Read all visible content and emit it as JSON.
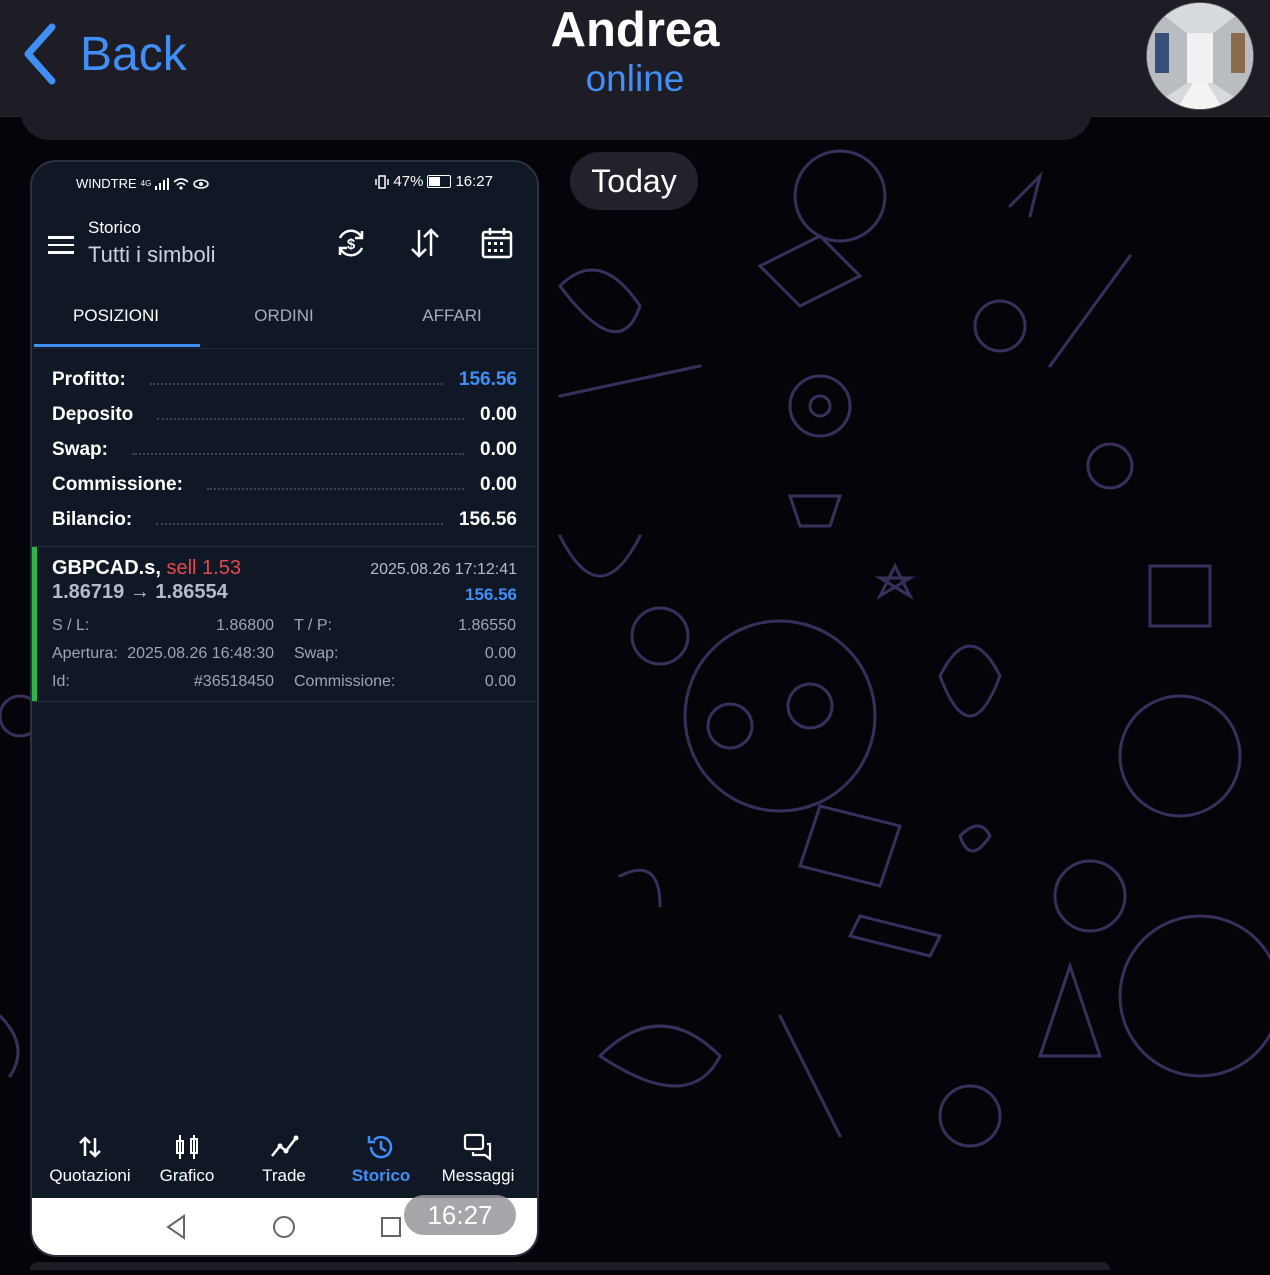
{
  "chat": {
    "back_label": "Back",
    "contact_name": "Andrea",
    "status": "online",
    "date_label": "Today",
    "message_time": "16:27"
  },
  "phone": {
    "status_bar": {
      "carrier": "WINDTRE",
      "network": "4G",
      "battery": "47%",
      "time": "16:27"
    },
    "header": {
      "title": "Storico",
      "subtitle": "Tutti i simboli"
    },
    "tabs": [
      {
        "label": "POSIZIONI",
        "active": true
      },
      {
        "label": "ORDINI",
        "active": false
      },
      {
        "label": "AFFARI",
        "active": false
      }
    ],
    "summary": [
      {
        "label": "Profitto:",
        "value": "156.56",
        "highlight": true
      },
      {
        "label": "Deposito",
        "value": "0.00",
        "highlight": false
      },
      {
        "label": "Swap:",
        "value": "0.00",
        "highlight": false
      },
      {
        "label": "Commissione:",
        "value": "0.00",
        "highlight": false
      },
      {
        "label": "Bilancio:",
        "value": "156.56",
        "highlight": false
      }
    ],
    "position": {
      "symbol": "GBPCAD.s,",
      "side": "sell 1.53",
      "datetime": "2025.08.26 17:12:41",
      "prices": "1.86719 → 1.86554",
      "profit": "156.56",
      "sl_label": "S / L:",
      "sl_value": "1.86800",
      "tp_label": "T / P:",
      "tp_value": "1.86550",
      "open_label": "Apertura:",
      "open_value": "2025.08.26 16:48:30",
      "swap_label": "Swap:",
      "swap_value": "0.00",
      "id_label": "Id:",
      "id_value": "#36518450",
      "comm_label": "Commissione:",
      "comm_value": "0.00"
    },
    "bottom_nav": [
      {
        "label": "Quotazioni",
        "icon": "arrows-updown-icon"
      },
      {
        "label": "Grafico",
        "icon": "candlestick-icon"
      },
      {
        "label": "Trade",
        "icon": "trend-line-icon"
      },
      {
        "label": "Storico",
        "icon": "history-icon",
        "active": true
      },
      {
        "label": "Messaggi",
        "icon": "chat-bubbles-icon"
      }
    ]
  },
  "colors": {
    "accent": "#3f8ff7",
    "sell": "#e5484d",
    "position_bar": "#2fb34f",
    "phone_bg": "#101826"
  }
}
